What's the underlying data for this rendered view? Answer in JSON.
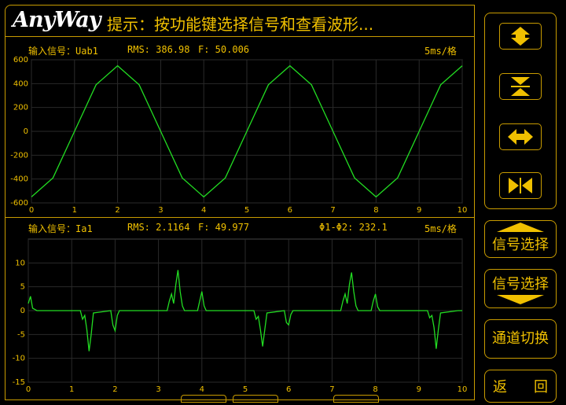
{
  "header": {
    "logo": "AnyWay",
    "hint": "提示：按功能键选择信号和查看波形..."
  },
  "panel1": {
    "signal_label": "输入信号：Uab1",
    "rms": "RMS: 386.98",
    "freq": "F: 50.006",
    "timebase": "5ms/格"
  },
  "panel2": {
    "signal_label": "输入信号：Ia1",
    "rms": "RMS: 2.1164",
    "freq": "F: 49.977",
    "phase": "Φ1-Φ2: 232.1",
    "timebase": "5ms/格"
  },
  "sidebar": {
    "icons": [
      "expand-vertical-icon",
      "compress-vertical-icon",
      "expand-horizontal-icon",
      "compress-horizontal-icon"
    ],
    "buttons": {
      "signal_select_up": "信号选择",
      "signal_select_down": "信号选择",
      "channel_switch": "通道切换",
      "back_1": "返",
      "back_2": "回"
    }
  },
  "colors": {
    "accent": "#f0c000",
    "frame": "#c89b00",
    "trace": "#22dd22",
    "grid": "#2a2a2a"
  },
  "chart_data": [
    {
      "type": "line",
      "title": "",
      "x": [
        0,
        1,
        2,
        3,
        4,
        5,
        6,
        7,
        8,
        9,
        10
      ],
      "xticks": [
        "0",
        "1",
        "2",
        "3",
        "4",
        "5",
        "6",
        "7",
        "8",
        "9",
        "10"
      ],
      "xlim": [
        0,
        10
      ],
      "ylim": [
        -600,
        600
      ],
      "yticks": [
        600,
        400,
        200,
        0,
        -200,
        -400,
        -600
      ],
      "grid": true,
      "series": [
        {
          "values_x": [
            0,
            0.5,
            1,
            1.5,
            2,
            2.5,
            3,
            3.5,
            4,
            4.5,
            5,
            5.5,
            6,
            6.5,
            7,
            7.5,
            8,
            8.5,
            9,
            9.5,
            10
          ],
          "values_y": [
            -550,
            -390,
            0,
            390,
            550,
            390,
            0,
            -390,
            -550,
            -390,
            0,
            390,
            550,
            390,
            0,
            -390,
            -550,
            -390,
            0,
            390,
            550
          ]
        }
      ]
    },
    {
      "type": "line",
      "title": "",
      "x": [
        0,
        1,
        2,
        3,
        4,
        5,
        6,
        7,
        8,
        9,
        10
      ],
      "xticks": [
        "0",
        "1",
        "2",
        "3",
        "4",
        "5",
        "6",
        "7",
        "8",
        "9",
        "10"
      ],
      "xlim": [
        0,
        10
      ],
      "ylim": [
        -15,
        15
      ],
      "yticks": [
        10,
        5,
        0,
        -5,
        -10,
        -15
      ],
      "grid": true,
      "series": [
        {
          "values_x": [
            0,
            0.05,
            0.1,
            0.2,
            1.2,
            1.25,
            1.3,
            1.35,
            1.4,
            1.45,
            1.5,
            1.9,
            1.95,
            2.0,
            2.05,
            2.1,
            3.2,
            3.25,
            3.3,
            3.35,
            3.4,
            3.45,
            3.5,
            3.55,
            3.6,
            3.9,
            3.95,
            4.0,
            4.05,
            4.1,
            5.2,
            5.25,
            5.3,
            5.35,
            5.4,
            5.45,
            5.5,
            5.9,
            5.95,
            6.0,
            6.05,
            6.1,
            7.2,
            7.25,
            7.3,
            7.35,
            7.4,
            7.45,
            7.5,
            7.55,
            7.6,
            7.9,
            7.95,
            8.0,
            8.05,
            8.1,
            9.2,
            9.25,
            9.3,
            9.35,
            9.4,
            9.45,
            9.5,
            9.9,
            10
          ],
          "values_y": [
            1.5,
            3.0,
            0.5,
            0,
            0,
            -1.8,
            -1.0,
            -4.0,
            -8.5,
            -5.0,
            -0.5,
            0,
            -3.0,
            -4.2,
            -1.0,
            0,
            0,
            2.0,
            3.5,
            1.5,
            5.5,
            8.5,
            4.0,
            1.0,
            0,
            0,
            2.0,
            4.0,
            1.0,
            0,
            0,
            -1.8,
            -1.2,
            -4.0,
            -7.5,
            -4.0,
            -0.5,
            0,
            -2.5,
            -3.0,
            -0.8,
            0,
            0,
            2.0,
            3.5,
            1.5,
            5.5,
            8.0,
            4.0,
            1.0,
            0,
            0,
            2.0,
            3.5,
            0.8,
            0,
            0,
            -1.5,
            -1.0,
            -3.5,
            -8.0,
            -4.0,
            -0.5,
            0,
            0
          ]
        }
      ]
    }
  ]
}
